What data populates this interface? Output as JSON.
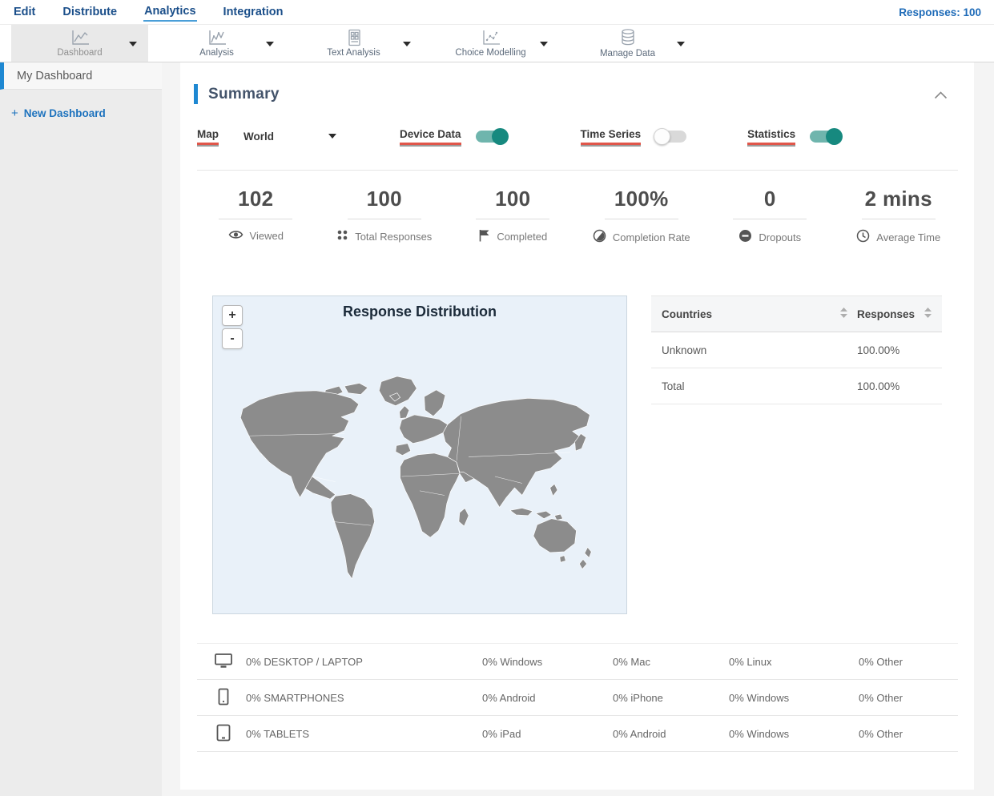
{
  "topnav": {
    "items": [
      {
        "label": "Edit",
        "active": false
      },
      {
        "label": "Distribute",
        "active": false
      },
      {
        "label": "Analytics",
        "active": true
      },
      {
        "label": "Integration",
        "active": false
      }
    ],
    "responses_badge": "Responses: 100"
  },
  "toolbar": {
    "items": [
      {
        "label": "Dashboard",
        "icon": "line-chart-icon",
        "selected": true
      },
      {
        "label": "Analysis",
        "icon": "analysis-chart-icon",
        "selected": false
      },
      {
        "label": "Text Analysis",
        "icon": "document-grid-icon",
        "selected": false
      },
      {
        "label": "Choice Modelling",
        "icon": "scatter-chart-icon",
        "selected": false
      },
      {
        "label": "Manage Data",
        "icon": "database-icon",
        "selected": false
      }
    ]
  },
  "sidebar": {
    "items": [
      {
        "label": "My Dashboard",
        "active": true
      }
    ],
    "new_dashboard_label": "New Dashboard",
    "new_dashboard_plus": "+"
  },
  "summary": {
    "title": "Summary",
    "controls": {
      "map_label": "Map",
      "map_value": "World",
      "device_data_label": "Device Data",
      "device_data_on": true,
      "time_series_label": "Time Series",
      "time_series_on": false,
      "statistics_label": "Statistics",
      "statistics_on": true
    },
    "stats": [
      {
        "value": "102",
        "label": "Viewed",
        "icon": "eye-icon"
      },
      {
        "value": "100",
        "label": "Total Responses",
        "icon": "dots-grid-icon"
      },
      {
        "value": "100",
        "label": "Completed",
        "icon": "flag-icon"
      },
      {
        "value": "100%",
        "label": "Completion Rate",
        "icon": "half-circle-icon"
      },
      {
        "value": "0",
        "label": "Dropouts",
        "icon": "minus-circle-icon"
      },
      {
        "value": "2 mins",
        "label": "Average Time",
        "icon": "clock-icon"
      }
    ],
    "map": {
      "title": "Response Distribution",
      "zoom_in": "+",
      "zoom_out": "-"
    },
    "countries_table": {
      "headers": {
        "col1": "Countries",
        "col2": "Responses"
      },
      "rows": [
        {
          "country": "Unknown",
          "responses": "100.00%"
        },
        {
          "country": "Total",
          "responses": "100.00%"
        }
      ]
    },
    "device_table": {
      "rows": [
        {
          "icon": "desktop-icon",
          "cells": [
            "0% DESKTOP / LAPTOP",
            "0% Windows",
            "0% Mac",
            "0% Linux",
            "0% Other"
          ]
        },
        {
          "icon": "smartphone-icon",
          "cells": [
            "0% SMARTPHONES",
            "0% Android",
            "0% iPhone",
            "0% Windows",
            "0% Other"
          ]
        },
        {
          "icon": "tablet-icon",
          "cells": [
            "0% TABLETS",
            "0% iPad",
            "0% Android",
            "0% Windows",
            "0% Other"
          ]
        }
      ]
    }
  },
  "colors": {
    "accent_blue": "#1e88d2",
    "nav_blue": "#1b4f8a",
    "link_blue": "#1e73be",
    "toggle_on_track": "#6fb5ad",
    "toggle_on_knob": "#17897f",
    "red_underline": "#e0564a",
    "map_background": "#e9f1f9",
    "map_land": "#8c8c8c"
  }
}
